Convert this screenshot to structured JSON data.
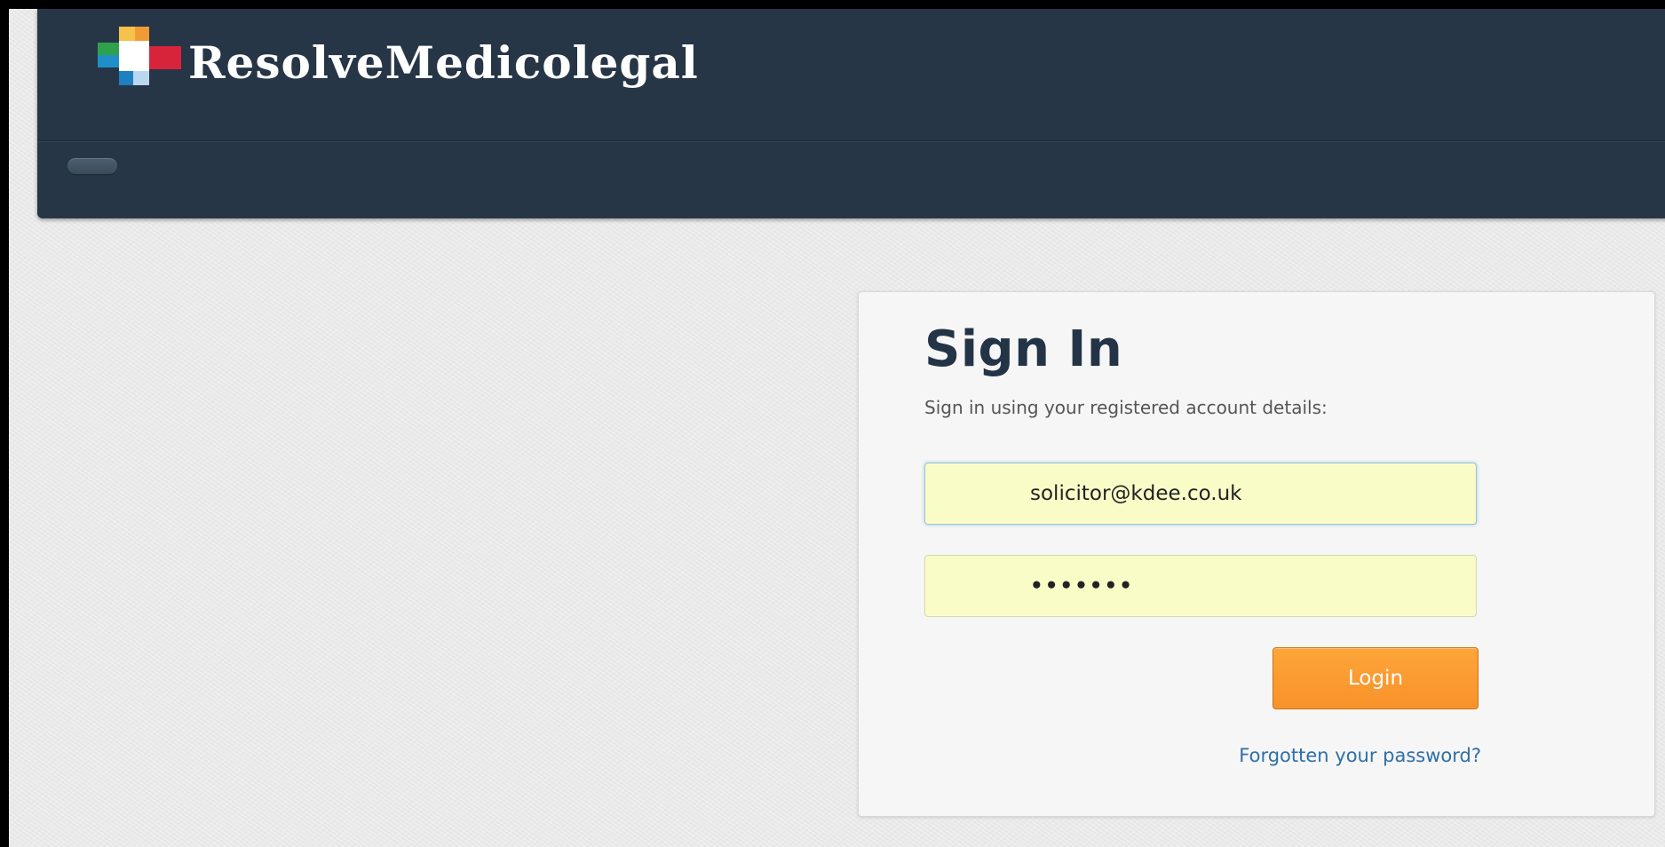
{
  "header": {
    "brand_name": "ResolveMedicolegal",
    "logo_icon": "medical-cross-logo-icon",
    "nav_toggle_icon": "nav-toggle-icon"
  },
  "signin": {
    "title": "Sign In",
    "subtitle": "Sign in using your registered account details:",
    "email": {
      "value": "solicitor@kdee.co.uk"
    },
    "password": {
      "value": "•••••••"
    },
    "login_label": "Login",
    "forgot_label": "Forgotten your password?"
  },
  "colors": {
    "navbar": "#263647",
    "accent_orange": "#f8922a",
    "link_blue": "#2e6fa7",
    "autofill_yellow": "#fafcc8",
    "page_background": "#e9e9e9"
  }
}
